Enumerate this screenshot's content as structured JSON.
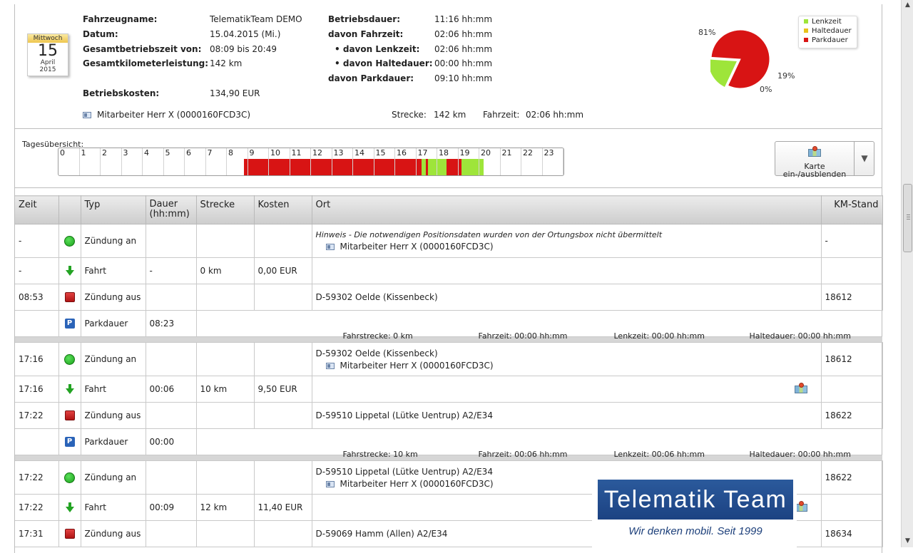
{
  "calendar": {
    "weekday": "Mittwoch",
    "day": "15",
    "month": "April",
    "year": "2015"
  },
  "info_left": [
    {
      "label": "Fahrzeugname:",
      "value": "TelematikTeam DEMO"
    },
    {
      "label": "Datum:",
      "value": "15.04.2015 (Mi.)"
    },
    {
      "label": "Gesamtbetriebszeit von:",
      "value": "08:09 bis 20:49"
    },
    {
      "label": "Gesamtkilometerleistung:",
      "value": "142 km"
    },
    {
      "label": "Betriebskosten:",
      "value": "134,90 EUR"
    }
  ],
  "info_right": [
    {
      "label": "Betriebsdauer:",
      "value": "11:16 hh:mm"
    },
    {
      "label": "davon Fahrzeit:",
      "value": "02:06 hh:mm"
    },
    {
      "label": "• davon Lenkzeit:",
      "value": "02:06 hh:mm"
    },
    {
      "label": "• davon Haltedauer:",
      "value": "00:00 hh:mm"
    },
    {
      "label": "davon Parkdauer:",
      "value": "09:10 hh:mm"
    }
  ],
  "summary": {
    "employee": "Mitarbeiter Herr X  (0000160FCD3C)",
    "distance_label": "Strecke:",
    "distance": "142 km",
    "drive_label": "Fahrzeit:",
    "drive": "02:06 hh:mm"
  },
  "chart_data": {
    "type": "pie",
    "slices": [
      {
        "name": "Lenkzeit",
        "value": 19,
        "label": "19%",
        "color": "#9ee53a"
      },
      {
        "name": "Haltedauer",
        "value": 0,
        "label": "0%",
        "color": "#e8c21c"
      },
      {
        "name": "Parkdauer",
        "value": 81,
        "label": "81%",
        "color": "#d81414"
      }
    ],
    "legend_placement": "top-right"
  },
  "day_overview": {
    "title": "Tagesübersicht:",
    "hours": [
      "0",
      "1",
      "2",
      "3",
      "4",
      "5",
      "6",
      "7",
      "8",
      "9",
      "10",
      "11",
      "12",
      "13",
      "14",
      "15",
      "16",
      "17",
      "18",
      "19",
      "20",
      "21",
      "22",
      "23"
    ],
    "segments": [
      {
        "state": "park",
        "start": 8.8,
        "end": 17.25
      },
      {
        "state": "drive",
        "start": 17.25,
        "end": 17.45
      },
      {
        "state": "park",
        "start": 17.45,
        "end": 17.55
      },
      {
        "state": "drive",
        "start": 17.55,
        "end": 18.45
      },
      {
        "state": "park",
        "start": 18.45,
        "end": 19.15
      },
      {
        "state": "drive",
        "start": 19.15,
        "end": 20.2
      }
    ],
    "colors": {
      "park": "#d81414",
      "drive": "#9ee53a"
    }
  },
  "map_button": {
    "line1": "Karte",
    "line2": "ein-/ausblenden"
  },
  "table": {
    "headers": [
      "Zeit",
      "",
      "Typ",
      "Dauer\n(hh:mm)",
      "Strecke",
      "Kosten",
      "Ort",
      "KM-Stand"
    ],
    "rows": [
      {
        "time": "-",
        "icon": "ignition-on",
        "type": "Zündung an",
        "duration": "",
        "distance": "",
        "cost": "",
        "place": "",
        "note": "Hinweis - Die notwendigen Positionsdaten wurden von der Ortungsbox nicht übermittelt",
        "sub": "Mitarbeiter Herr X (0000160FCD3C)",
        "km": "-"
      },
      {
        "time": "-",
        "icon": "drive",
        "type": "Fahrt",
        "duration": "-",
        "distance": "0 km",
        "cost": "0,00 EUR",
        "place": "",
        "km": ""
      },
      {
        "time": "08:53",
        "icon": "ignition-off",
        "type": "Zündung aus",
        "duration": "",
        "distance": "",
        "cost": "",
        "place": "D-59302 Oelde (Kissenbeck)",
        "km": "18612"
      },
      {
        "park": true,
        "type": "Parkdauer",
        "duration": "08:23",
        "stats": [
          "Fahrstrecke: 0 km",
          "Fahrzeit: 00:00 hh:mm",
          "Lenkzeit: 00:00 hh:mm",
          "Haltedauer: 00:00 hh:mm"
        ]
      },
      {
        "sep": true
      },
      {
        "time": "17:16",
        "icon": "ignition-on",
        "type": "Zündung an",
        "duration": "",
        "distance": "",
        "cost": "",
        "place": "D-59302 Oelde (Kissenbeck)",
        "sub": "Mitarbeiter Herr X (0000160FCD3C)",
        "km": "18612"
      },
      {
        "time": "17:16",
        "icon": "drive",
        "type": "Fahrt",
        "duration": "00:06",
        "distance": "10 km",
        "cost": "9,50 EUR",
        "place": "",
        "map": true,
        "km": ""
      },
      {
        "time": "17:22",
        "icon": "ignition-off",
        "type": "Zündung aus",
        "duration": "",
        "distance": "",
        "cost": "",
        "place": "D-59510 Lippetal (Lütke Uentrup) A2/E34",
        "km": "18622"
      },
      {
        "park": true,
        "type": "Parkdauer",
        "duration": "00:00",
        "stats": [
          "Fahrstrecke: 10 km",
          "Fahrzeit: 00:06 hh:mm",
          "Lenkzeit: 00:06 hh:mm",
          "Haltedauer: 00:00 hh:mm"
        ]
      },
      {
        "sep": true
      },
      {
        "time": "17:22",
        "icon": "ignition-on",
        "type": "Zündung an",
        "duration": "",
        "distance": "",
        "cost": "",
        "place": "D-59510 Lippetal (Lütke Uentrup) A2/E34",
        "sub": "Mitarbeiter Herr X (0000160FCD3C)",
        "km": "18622"
      },
      {
        "time": "17:22",
        "icon": "drive",
        "type": "Fahrt",
        "duration": "00:09",
        "distance": "12 km",
        "cost": "11,40 EUR",
        "place": "",
        "map": true,
        "km": ""
      },
      {
        "time": "17:31",
        "icon": "ignition-off",
        "type": "Zündung aus",
        "duration": "",
        "distance": "",
        "cost": "",
        "place": "D-59069 Hamm (Allen) A2/E34",
        "km": "18634"
      }
    ]
  },
  "logo": {
    "name": "Telematik Team",
    "slogan": "Wir denken mobil. Seit 1999"
  }
}
